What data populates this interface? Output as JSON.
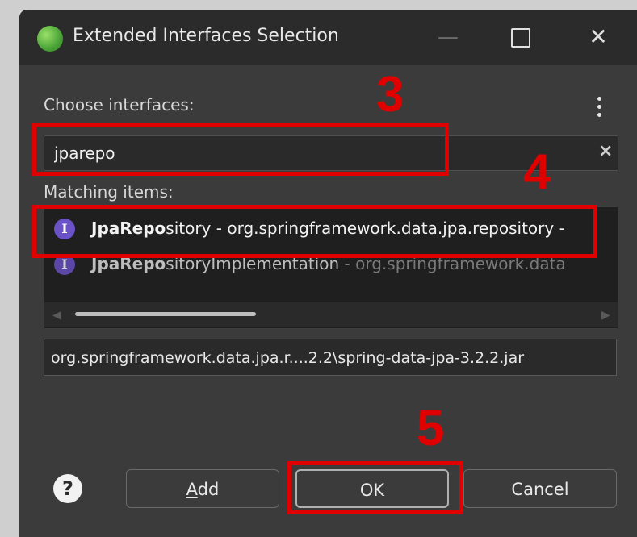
{
  "dialog": {
    "title": "Extended Interfaces Selection",
    "choose_label": "Choose interfaces:",
    "search_value": "jparepo",
    "matching_label": "Matching items:",
    "items": [
      {
        "match": "JpaRepo",
        "rest": "sitory",
        "package": " - org.springframework.data.jpa.repository - "
      },
      {
        "match": "JpaRepo",
        "rest": "sitoryImplementation",
        "package": " - org.springframework.data"
      }
    ],
    "path_text": "org.springframework.data.jpa.r....2.2\\spring-data-jpa-3.2.2.jar",
    "buttons": {
      "add": "Add",
      "ok": "OK",
      "cancel": "Cancel"
    },
    "help_glyph": "?",
    "window_controls": {
      "minimize": "—",
      "close": "✕"
    }
  },
  "annotations": [
    "3",
    "4",
    "5"
  ],
  "colors": {
    "annotation": "#e00000",
    "background": "#3b3b3b",
    "titlebar": "#2b2b2b"
  }
}
